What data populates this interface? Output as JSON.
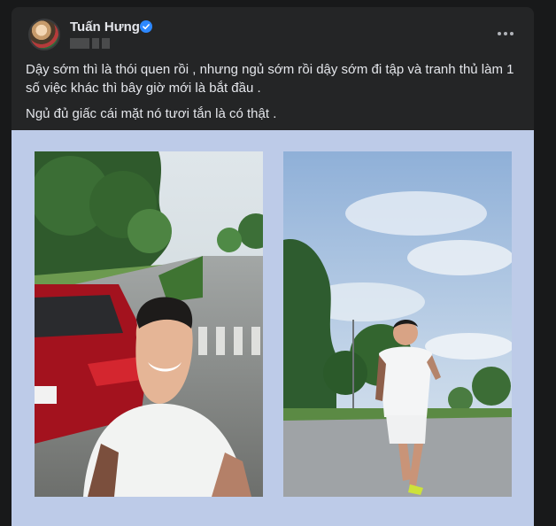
{
  "post": {
    "author": "Tuấn Hưng",
    "caption_line1": "Dậy sớm thì là thói quen rồi , nhưng ngủ sớm rồi dậy sớm đi tập và tranh thủ làm 1 số việc khác thì bây giờ mới là bắt đầu .",
    "caption_line2": "Ngủ đủ giấc cái mặt nó tươi tắn là có thật ."
  },
  "icons": [
    "verified-badge-icon",
    "more-options-icon"
  ],
  "colors": {
    "background": "#18191a",
    "card": "#242526",
    "text": "#e4e6eb",
    "verified": "#2d88ff",
    "media_bg": "#bdcbe8"
  },
  "photos": [
    {
      "name": "selfie-by-red-car"
    },
    {
      "name": "running-on-road"
    }
  ]
}
